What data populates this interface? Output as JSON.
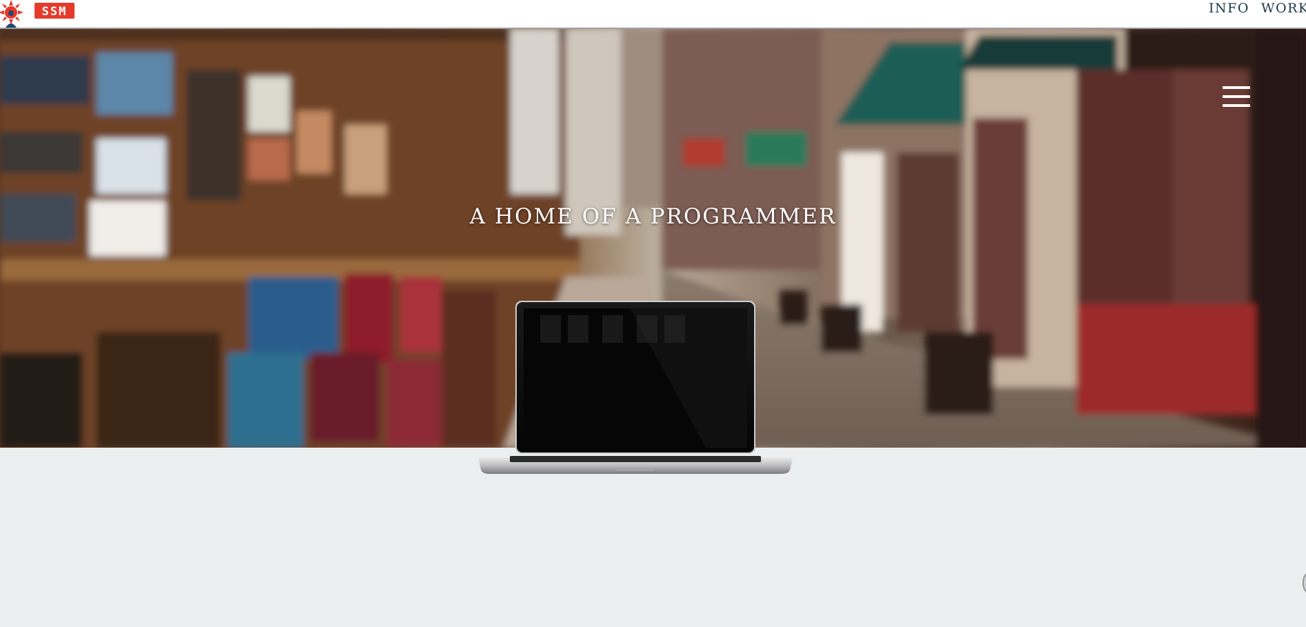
{
  "header": {
    "logo_icon": "sun-icon",
    "logo_text": "SSM",
    "nav": [
      {
        "label": "INFO"
      },
      {
        "label": "WORKS"
      }
    ]
  },
  "hero": {
    "title": "A HOME OF A PROGRAMMER",
    "menu_icon": "hamburger-menu-icon",
    "background": "blurred library bookshelves and street storefronts",
    "device_icon": "laptop-icon"
  },
  "colors": {
    "nav_text": "#1e3746",
    "page_background": "#eceff0",
    "logo_red": "#e53b2c",
    "hero_text": "#ffffff"
  }
}
